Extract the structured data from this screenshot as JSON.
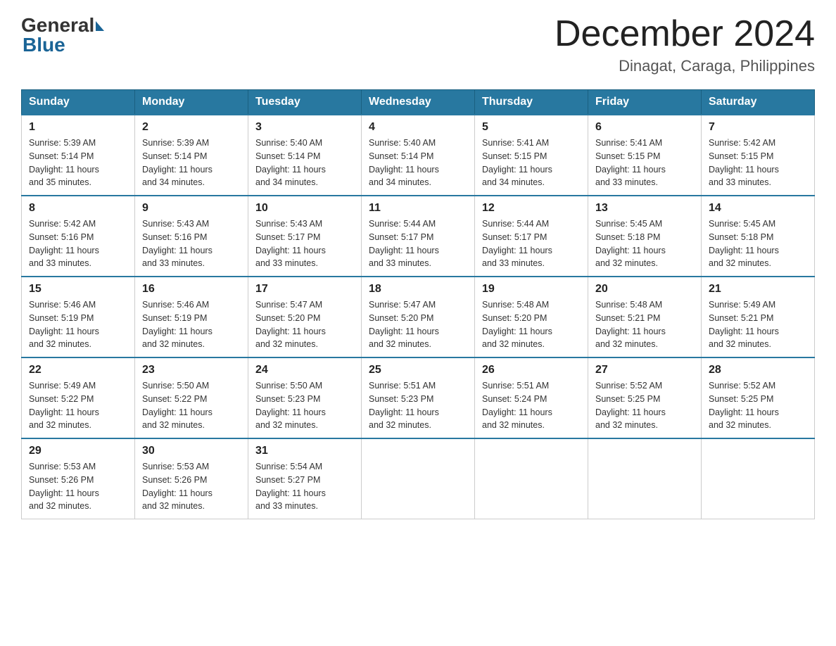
{
  "logo": {
    "text_general": "General",
    "text_blue": "Blue"
  },
  "header": {
    "month_year": "December 2024",
    "location": "Dinagat, Caraga, Philippines"
  },
  "weekdays": [
    "Sunday",
    "Monday",
    "Tuesday",
    "Wednesday",
    "Thursday",
    "Friday",
    "Saturday"
  ],
  "weeks": [
    [
      {
        "day": "1",
        "sunrise": "5:39 AM",
        "sunset": "5:14 PM",
        "daylight": "11 hours and 35 minutes."
      },
      {
        "day": "2",
        "sunrise": "5:39 AM",
        "sunset": "5:14 PM",
        "daylight": "11 hours and 34 minutes."
      },
      {
        "day": "3",
        "sunrise": "5:40 AM",
        "sunset": "5:14 PM",
        "daylight": "11 hours and 34 minutes."
      },
      {
        "day": "4",
        "sunrise": "5:40 AM",
        "sunset": "5:14 PM",
        "daylight": "11 hours and 34 minutes."
      },
      {
        "day": "5",
        "sunrise": "5:41 AM",
        "sunset": "5:15 PM",
        "daylight": "11 hours and 34 minutes."
      },
      {
        "day": "6",
        "sunrise": "5:41 AM",
        "sunset": "5:15 PM",
        "daylight": "11 hours and 33 minutes."
      },
      {
        "day": "7",
        "sunrise": "5:42 AM",
        "sunset": "5:15 PM",
        "daylight": "11 hours and 33 minutes."
      }
    ],
    [
      {
        "day": "8",
        "sunrise": "5:42 AM",
        "sunset": "5:16 PM",
        "daylight": "11 hours and 33 minutes."
      },
      {
        "day": "9",
        "sunrise": "5:43 AM",
        "sunset": "5:16 PM",
        "daylight": "11 hours and 33 minutes."
      },
      {
        "day": "10",
        "sunrise": "5:43 AM",
        "sunset": "5:17 PM",
        "daylight": "11 hours and 33 minutes."
      },
      {
        "day": "11",
        "sunrise": "5:44 AM",
        "sunset": "5:17 PM",
        "daylight": "11 hours and 33 minutes."
      },
      {
        "day": "12",
        "sunrise": "5:44 AM",
        "sunset": "5:17 PM",
        "daylight": "11 hours and 33 minutes."
      },
      {
        "day": "13",
        "sunrise": "5:45 AM",
        "sunset": "5:18 PM",
        "daylight": "11 hours and 32 minutes."
      },
      {
        "day": "14",
        "sunrise": "5:45 AM",
        "sunset": "5:18 PM",
        "daylight": "11 hours and 32 minutes."
      }
    ],
    [
      {
        "day": "15",
        "sunrise": "5:46 AM",
        "sunset": "5:19 PM",
        "daylight": "11 hours and 32 minutes."
      },
      {
        "day": "16",
        "sunrise": "5:46 AM",
        "sunset": "5:19 PM",
        "daylight": "11 hours and 32 minutes."
      },
      {
        "day": "17",
        "sunrise": "5:47 AM",
        "sunset": "5:20 PM",
        "daylight": "11 hours and 32 minutes."
      },
      {
        "day": "18",
        "sunrise": "5:47 AM",
        "sunset": "5:20 PM",
        "daylight": "11 hours and 32 minutes."
      },
      {
        "day": "19",
        "sunrise": "5:48 AM",
        "sunset": "5:20 PM",
        "daylight": "11 hours and 32 minutes."
      },
      {
        "day": "20",
        "sunrise": "5:48 AM",
        "sunset": "5:21 PM",
        "daylight": "11 hours and 32 minutes."
      },
      {
        "day": "21",
        "sunrise": "5:49 AM",
        "sunset": "5:21 PM",
        "daylight": "11 hours and 32 minutes."
      }
    ],
    [
      {
        "day": "22",
        "sunrise": "5:49 AM",
        "sunset": "5:22 PM",
        "daylight": "11 hours and 32 minutes."
      },
      {
        "day": "23",
        "sunrise": "5:50 AM",
        "sunset": "5:22 PM",
        "daylight": "11 hours and 32 minutes."
      },
      {
        "day": "24",
        "sunrise": "5:50 AM",
        "sunset": "5:23 PM",
        "daylight": "11 hours and 32 minutes."
      },
      {
        "day": "25",
        "sunrise": "5:51 AM",
        "sunset": "5:23 PM",
        "daylight": "11 hours and 32 minutes."
      },
      {
        "day": "26",
        "sunrise": "5:51 AM",
        "sunset": "5:24 PM",
        "daylight": "11 hours and 32 minutes."
      },
      {
        "day": "27",
        "sunrise": "5:52 AM",
        "sunset": "5:25 PM",
        "daylight": "11 hours and 32 minutes."
      },
      {
        "day": "28",
        "sunrise": "5:52 AM",
        "sunset": "5:25 PM",
        "daylight": "11 hours and 32 minutes."
      }
    ],
    [
      {
        "day": "29",
        "sunrise": "5:53 AM",
        "sunset": "5:26 PM",
        "daylight": "11 hours and 32 minutes."
      },
      {
        "day": "30",
        "sunrise": "5:53 AM",
        "sunset": "5:26 PM",
        "daylight": "11 hours and 32 minutes."
      },
      {
        "day": "31",
        "sunrise": "5:54 AM",
        "sunset": "5:27 PM",
        "daylight": "11 hours and 33 minutes."
      },
      null,
      null,
      null,
      null
    ]
  ],
  "labels": {
    "sunrise": "Sunrise:",
    "sunset": "Sunset:",
    "daylight": "Daylight:"
  }
}
